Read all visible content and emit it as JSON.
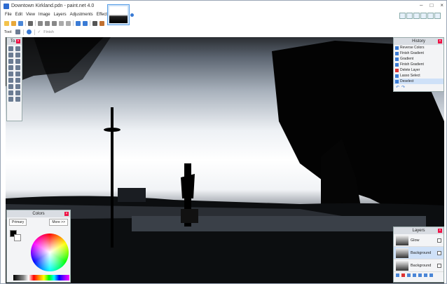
{
  "window": {
    "title": "Downtown Kirkland.pdn - paint.net 4.0"
  },
  "menu": [
    "File",
    "Edit",
    "View",
    "Image",
    "Layers",
    "Adjustments",
    "Effects"
  ],
  "toolbar": {
    "tool_label": "Tool:",
    "finish_label": "Finish"
  },
  "tools_panel": {
    "title": "To..."
  },
  "history_panel": {
    "title": "History",
    "items": [
      "Reverse Colors",
      "Finish Gradient",
      "Gradient",
      "Finish Gradient",
      "Delete Layer",
      "Lasso Select",
      "Deselect"
    ],
    "selected_index": 6
  },
  "colors_panel": {
    "title": "Colors",
    "mode": "Primary",
    "more_label": "More >>"
  },
  "layers_panel": {
    "title": "Layers",
    "layers": [
      "Glow",
      "Background",
      "Background"
    ],
    "selected_index": 1
  }
}
